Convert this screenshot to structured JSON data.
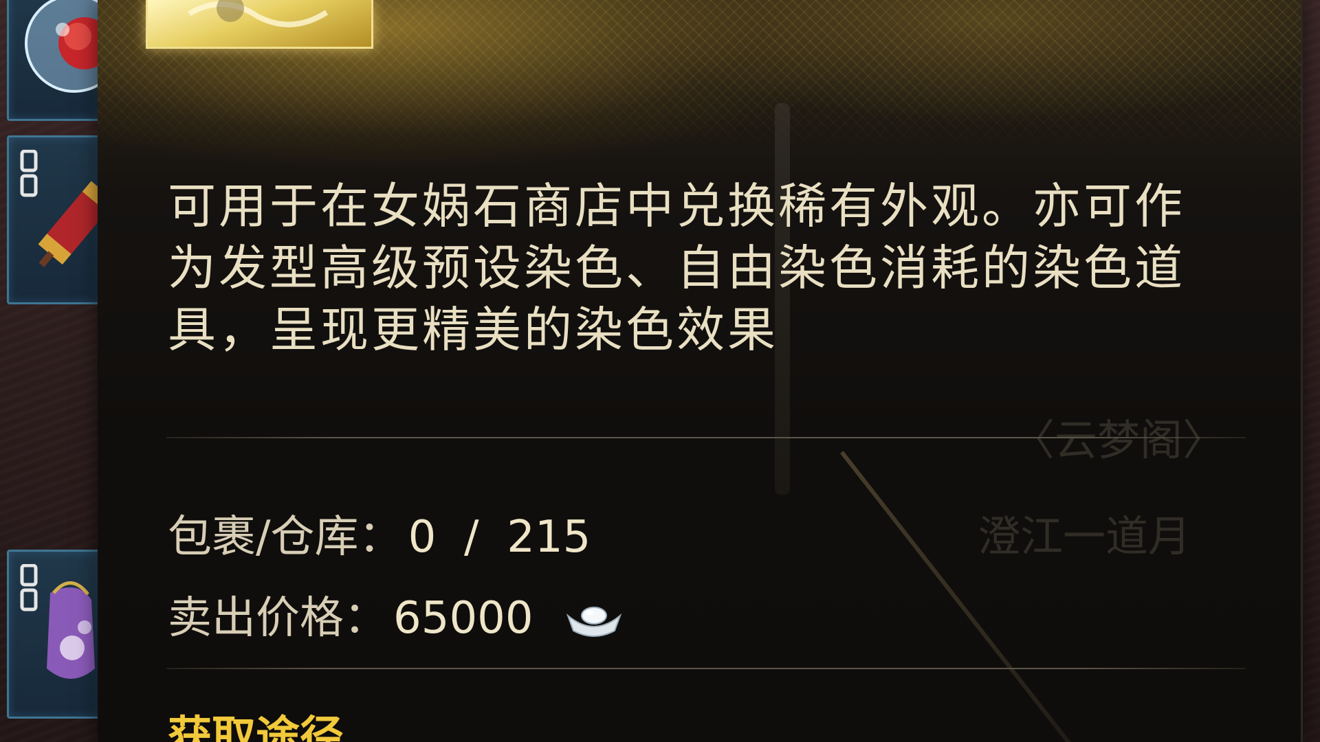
{
  "inventory": {
    "slots": [
      {
        "name": "rose-orb-item",
        "locked": false
      },
      {
        "name": "scroll-item",
        "locked": true
      },
      {
        "name": "pouch-item",
        "locked": true
      }
    ]
  },
  "tooltip": {
    "description": "可用于在女娲石商店中兑换稀有外观。亦可作为发型高级预设染色、自由染色消耗的染色道具，呈现更精美的染色效果",
    "bag_label": "包裹/仓库：",
    "bag_value": "0  /  215",
    "sell_label": "卖出价格：",
    "sell_value": "65000",
    "currency_icon": "silver-ingot-icon",
    "source_title": "获取途径"
  },
  "background": {
    "ghost_title": "〈云梦阁〉",
    "ghost_sub": "澄江一道月"
  },
  "colors": {
    "gold_header": "#c9a23a",
    "source_title": "#f2c93a",
    "text": "#e9dfc2",
    "slot_border": "#3f7693"
  }
}
